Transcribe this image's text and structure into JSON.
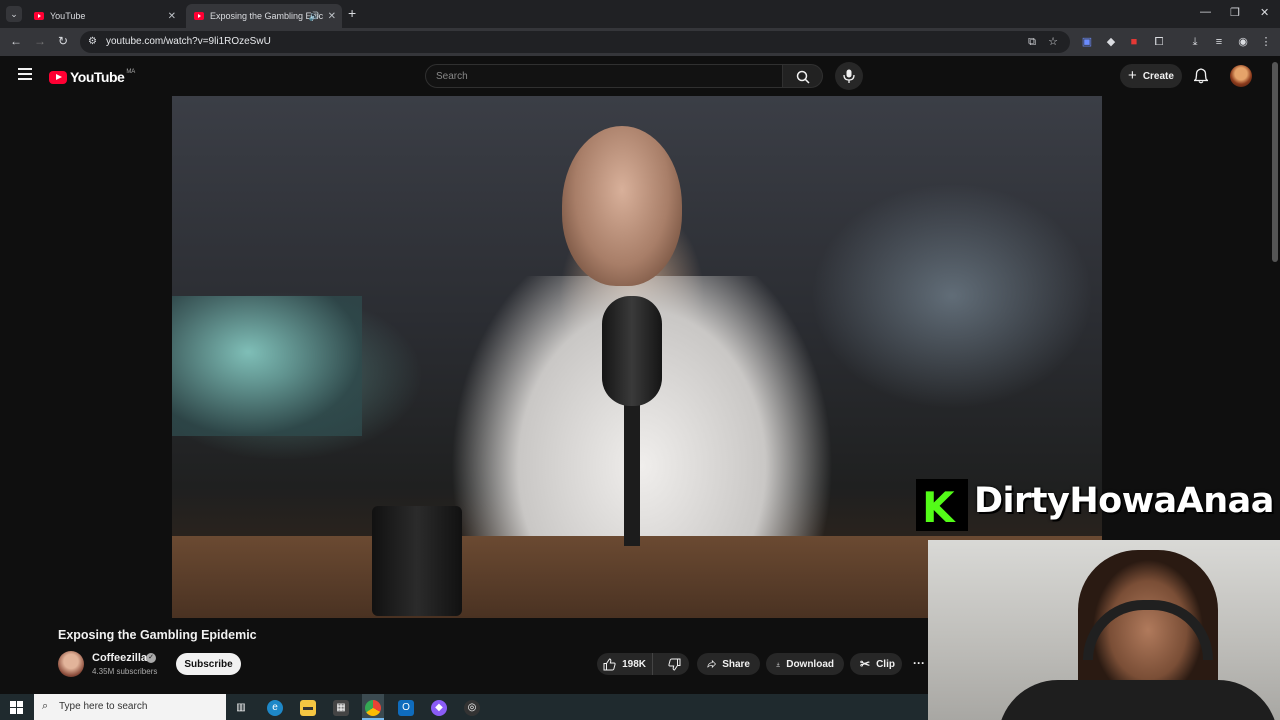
{
  "browser": {
    "tabs": [
      {
        "label": "YouTube"
      },
      {
        "label": "Exposing the Gambling Epic"
      }
    ],
    "url": "youtube.com/watch?v=9li1ROzeSwU"
  },
  "masthead": {
    "logo_text": "YouTube",
    "country_code": "MA",
    "search_placeholder": "Search",
    "create_label": "Create"
  },
  "video": {
    "title": "Exposing the Gambling Epidemic",
    "channel": {
      "name": "Coffeezilla",
      "subscribers": "4.35M subscribers",
      "subscribe_label": "Subscribe"
    },
    "actions": {
      "likes": "198K",
      "share_label": "Share",
      "download_label": "Download",
      "clip_label": "Clip"
    }
  },
  "overlay": {
    "platform_icon": "kick-logo",
    "kick_letter": "K",
    "streamer_name": "DirtyHowaAnaa"
  },
  "taskbar": {
    "search_placeholder": "Type here to search"
  },
  "colors": {
    "youtube_red": "#ff0033",
    "kick_green": "#53fc18",
    "background": "#0f0f0f"
  }
}
